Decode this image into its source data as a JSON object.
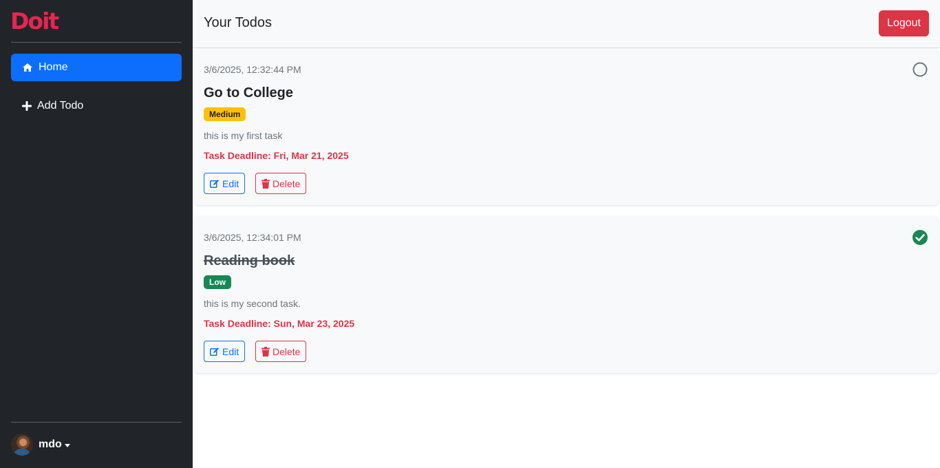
{
  "sidebar": {
    "logo": "Doit",
    "nav": [
      {
        "label": "Home",
        "icon": "home-icon",
        "active": true
      },
      {
        "label": "Add Todo",
        "icon": "plus-icon",
        "active": false
      }
    ],
    "user": {
      "name": "mdo"
    }
  },
  "header": {
    "title": "Your Todos",
    "logout_label": "Logout"
  },
  "todos": [
    {
      "timestamp": "3/6/2025, 12:32:44 PM",
      "title": "Go to College",
      "priority": "Medium",
      "description": "this is my first task",
      "deadline": "Task Deadline: Fri, Mar 21, 2025",
      "completed": false,
      "edit_label": "Edit",
      "delete_label": "Delete"
    },
    {
      "timestamp": "3/6/2025, 12:34:01 PM",
      "title": "Reading book",
      "priority": "Low",
      "description": "this is my second task.",
      "deadline": "Task Deadline: Sun, Mar 23, 2025",
      "completed": true,
      "edit_label": "Edit",
      "delete_label": "Delete"
    }
  ],
  "colors": {
    "sidebar_bg": "#212529",
    "primary": "#0d6efd",
    "danger": "#dc3545",
    "warning": "#ffc107",
    "success": "#198754",
    "logo": "#e5264f"
  }
}
